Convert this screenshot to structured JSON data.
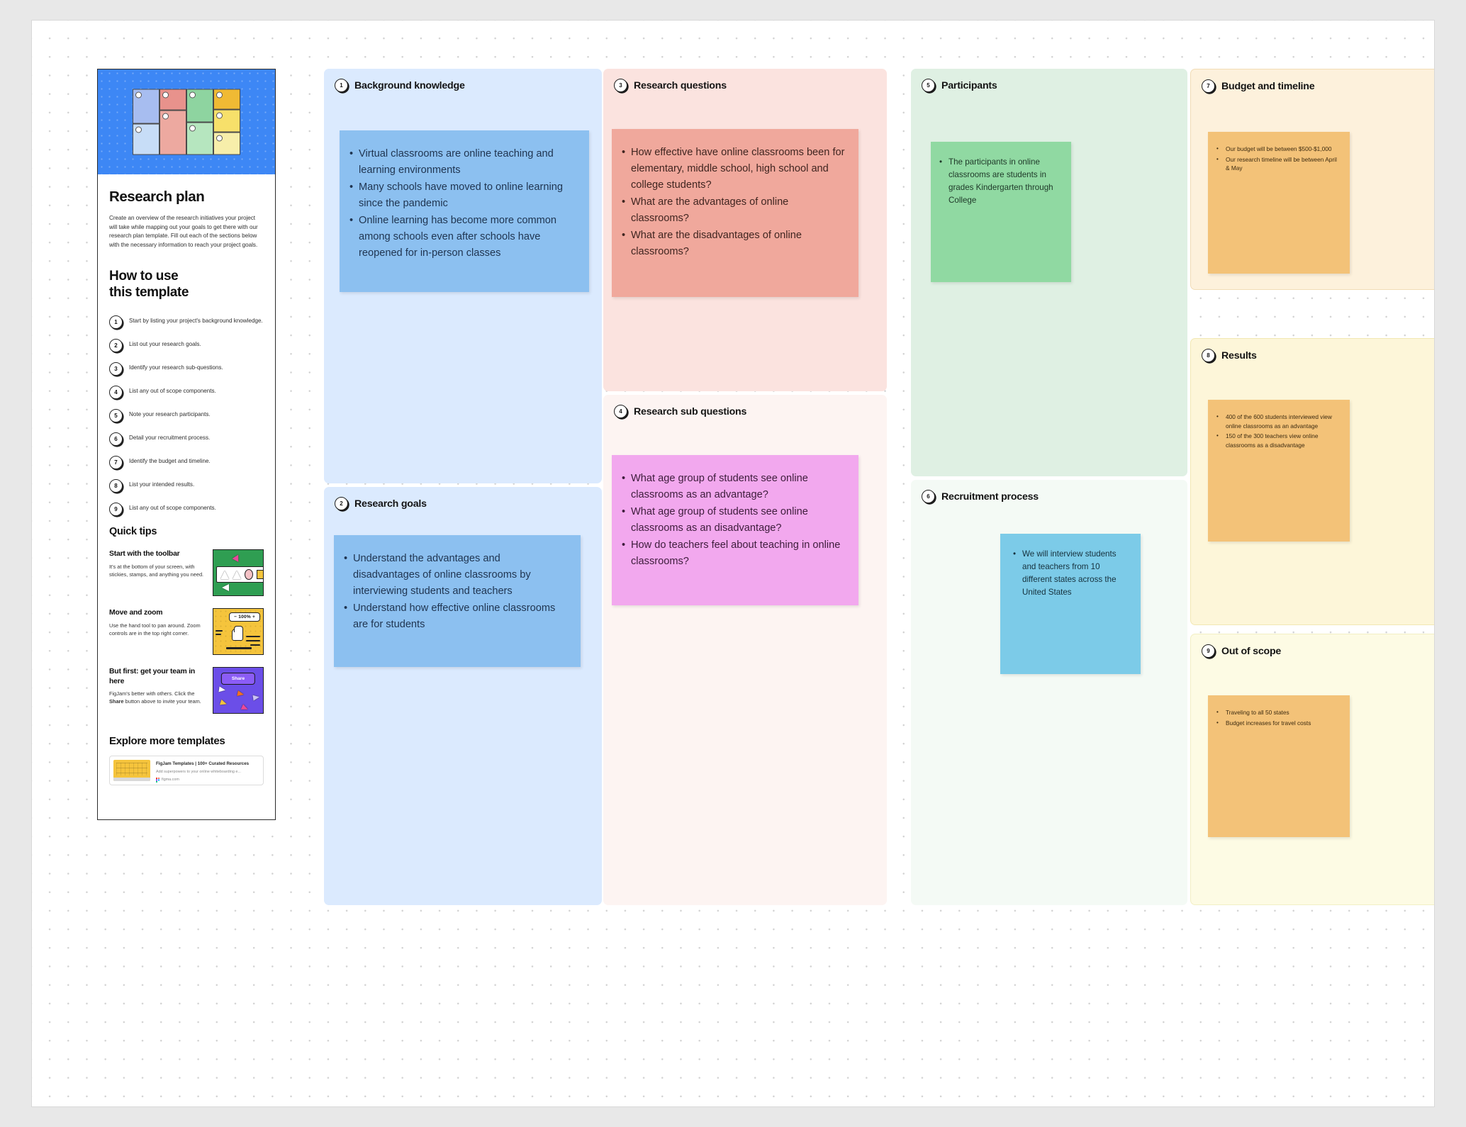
{
  "board": {
    "title": "Research plan"
  },
  "template_card": {
    "title": "Research plan",
    "intro": "Create an overview of the research initiatives your project will take while mapping out your goals to get there with our research plan template. Fill out each of the sections below with the necessary information to reach your project goals.",
    "how_to_heading_line1": "How to use",
    "how_to_heading_line2": "this template",
    "steps": [
      {
        "num": "1",
        "text": "Start by listing your project's background knowledge."
      },
      {
        "num": "2",
        "text": "List out your research goals."
      },
      {
        "num": "3",
        "text": "Identify your research sub-questions."
      },
      {
        "num": "4",
        "text": "List any out of scope components."
      },
      {
        "num": "5",
        "text": "Note your research participants."
      },
      {
        "num": "6",
        "text": "Detail your recruitment process."
      },
      {
        "num": "7",
        "text": "Identify the budget and timeline."
      },
      {
        "num": "8",
        "text": "List your intended results."
      },
      {
        "num": "9",
        "text": "List any out of scope components."
      }
    ],
    "quick_tips_heading": "Quick tips",
    "tips": [
      {
        "title": "Start with the toolbar",
        "desc": "It's at the bottom of your screen, with stickies, stamps, and anything you need."
      },
      {
        "title": "Move and zoom",
        "desc": "Use the hand tool to pan around. Zoom controls are in the top right corner.",
        "zoom_label": "100%",
        "zoom_minus": "−",
        "zoom_plus": "+"
      },
      {
        "title": "But first: get your team in here",
        "desc_pre": "FigJam's better with others. Click the ",
        "desc_bold": "Share",
        "desc_post": " button above to invite your team.",
        "share_label": "Share"
      }
    ],
    "explore_heading": "Explore more templates",
    "link_card": {
      "title": "FigJam Templates | 100+ Curated Resources",
      "desc": "Add superpowers to your online whiteboarding e...",
      "source": "figma.com"
    }
  },
  "sections": [
    {
      "num": "1",
      "title": "Background knowledge",
      "items": [
        "Virtual classrooms are online teaching and learning environments",
        "Many schools have moved to online learning since the pandemic",
        "Online learning has become more common among schools even after schools have reopened for in-person classes"
      ]
    },
    {
      "num": "2",
      "title": "Research goals",
      "items": [
        "Understand the advantages and disadvantages of online classrooms by interviewing students and teachers",
        "Understand how effective online classrooms are for students"
      ]
    },
    {
      "num": "3",
      "title": "Research questions",
      "items": [
        "How effective have online classrooms been for elementary, middle school, high school and college students?",
        "What are the advantages of online classrooms?",
        "What are the disadvantages of online classrooms?"
      ]
    },
    {
      "num": "4",
      "title": "Research sub questions",
      "items": [
        " What age group of students see online classrooms as an advantage?",
        "What age group of students see online classrooms as an disadvantage?",
        "How do teachers feel about teaching in online classrooms?"
      ]
    },
    {
      "num": "5",
      "title": "Participants",
      "items": [
        "The participants in online classrooms are students in grades Kindergarten through College"
      ]
    },
    {
      "num": "6",
      "title": "Recruitment process",
      "items": [
        "We will interview students and teachers from 10 different states across the United States"
      ]
    },
    {
      "num": "7",
      "title": "Budget and timeline",
      "items": [
        "Our budget will be between $500-$1,000",
        "Our research timeline will be between April & May"
      ]
    },
    {
      "num": "8",
      "title": "Results",
      "items": [
        "400 of the 600 students interviewed view online classrooms as an advantage",
        "150 of the 300 teachers view online classrooms as a disadvantage"
      ]
    },
    {
      "num": "9",
      "title": "Out of scope",
      "items": [
        "Traveling to all 50 states",
        "Budget increases for travel costs"
      ]
    }
  ],
  "colors": {
    "blue_section": "#dbeafe",
    "blue_note": "#8cc0f0",
    "red_section": "#fbe3df",
    "red_note": "#f0a89c",
    "pink_note": "#f2a8ee",
    "green_section": "#dff0e3",
    "green_note": "#90d9a2",
    "cyan_note": "#7ccbe8",
    "orange_section": "#fdf1dc",
    "yellow_section": "#fdf6d9",
    "cream_section": "#fdfbe4",
    "orange_note": "#f3c278",
    "hero_blue": "#3d87f5"
  }
}
